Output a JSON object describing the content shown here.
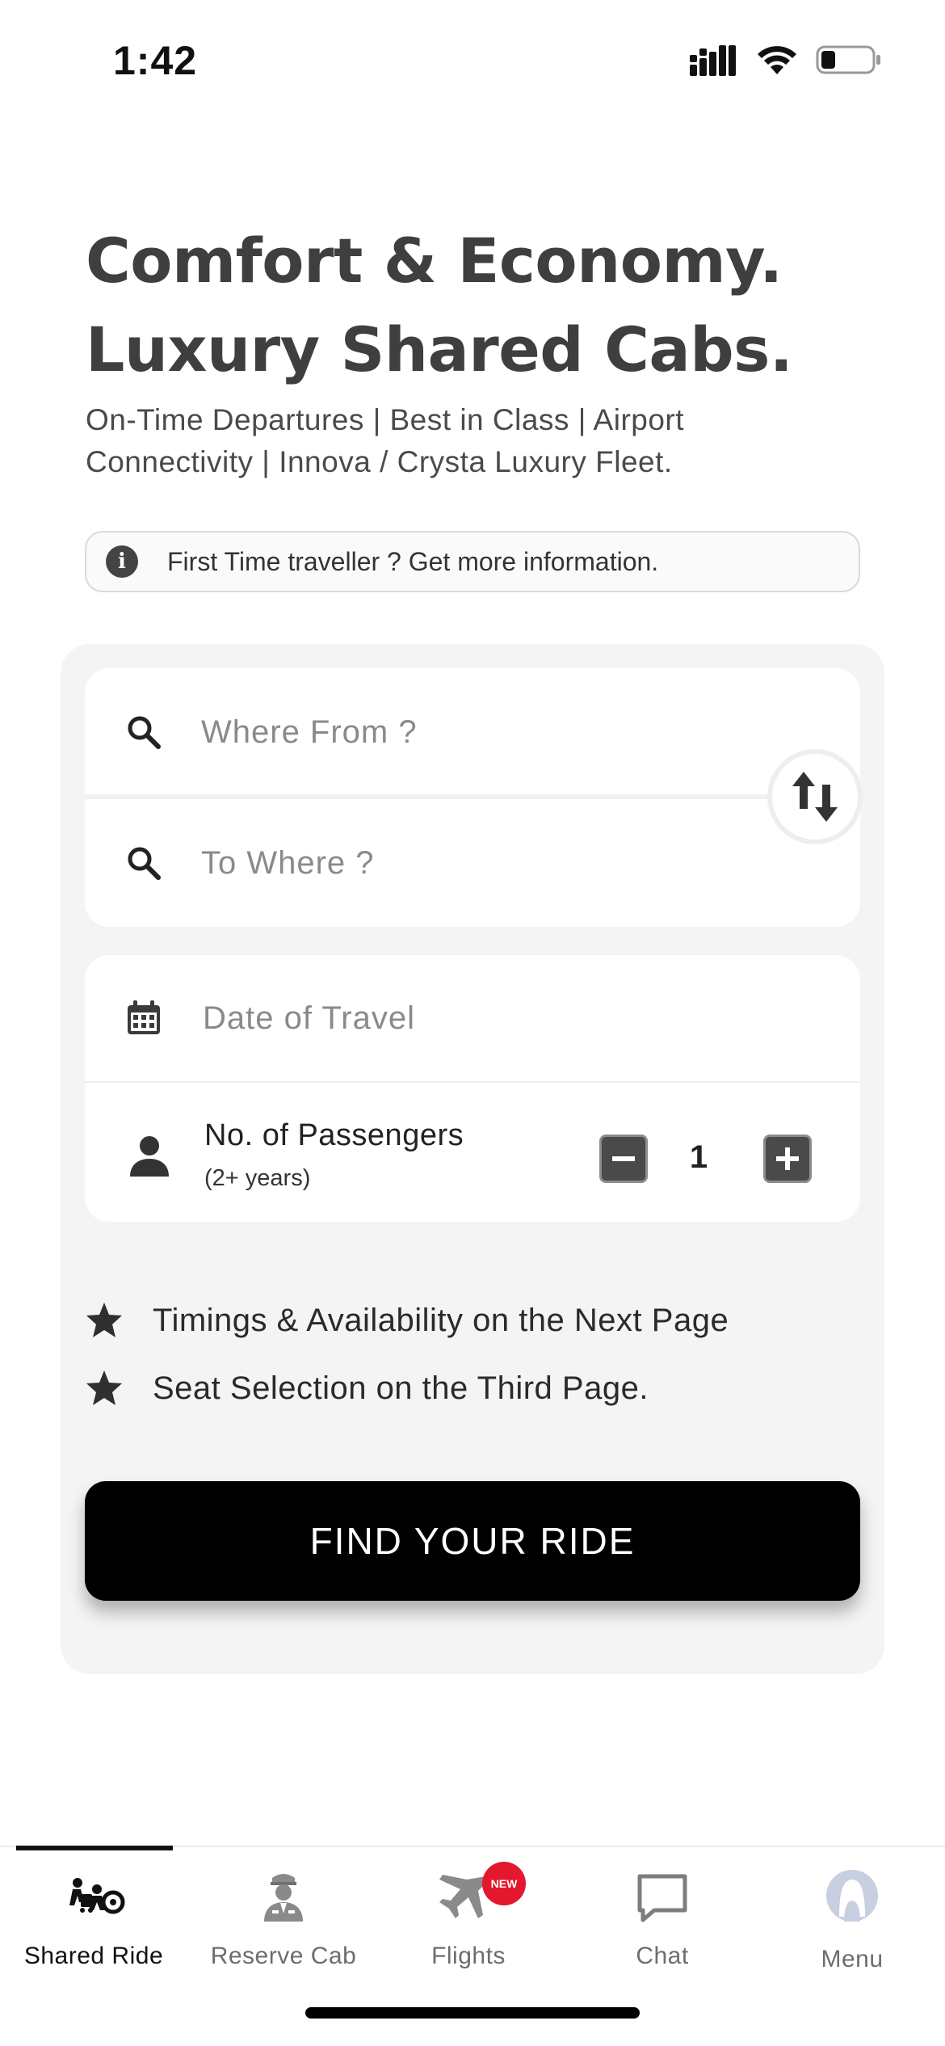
{
  "status_bar": {
    "time": "1:42"
  },
  "hero": {
    "title_line1": "Comfort & Economy.",
    "title_line2": "Luxury Shared Cabs.",
    "subtitle": "On-Time Departures | Best in Class | Airport Connectivity | Innova / Crysta Luxury Fleet."
  },
  "info_banner": {
    "text": "First Time traveller ? Get more information."
  },
  "booking": {
    "from_placeholder": "Where From ?",
    "to_placeholder": "To Where ?",
    "date_placeholder": "Date of Travel",
    "passengers": {
      "label": "No. of Passengers",
      "sublabel": "(2+ years)",
      "count": "1"
    },
    "notes": [
      {
        "text": "Timings & Availability on the Next Page"
      },
      {
        "text": "Seat Selection on the Third Page."
      }
    ],
    "find_button": "FIND YOUR RIDE"
  },
  "tabs": [
    {
      "label": "Shared Ride",
      "icon": "shared-ride-icon",
      "active": true
    },
    {
      "label": "Reserve Cab",
      "icon": "driver-icon",
      "active": false
    },
    {
      "label": "Flights",
      "icon": "airplane-icon",
      "active": false,
      "badge": "NEW"
    },
    {
      "label": "Chat",
      "icon": "chat-bubble-icon",
      "active": false
    },
    {
      "label": "Menu",
      "icon": "avatar-icon",
      "active": false
    }
  ],
  "colors": {
    "accent": "#000000",
    "text_dark": "#3f3f3f",
    "card_bg": "#f4f4f4",
    "badge_red": "#e3172d"
  }
}
